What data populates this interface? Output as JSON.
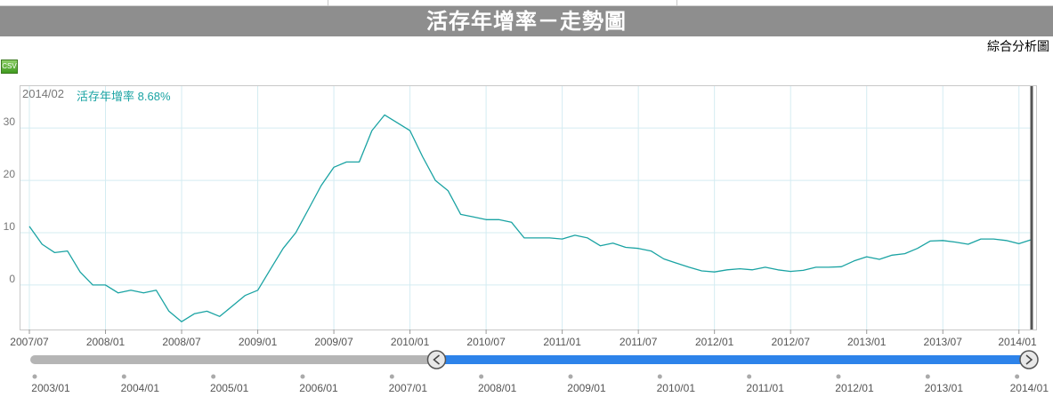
{
  "header": {
    "title": "活存年增率－走勢圖"
  },
  "links": {
    "analysis": "綜合分析圖"
  },
  "toolbar": {
    "csv_label": "CSV",
    "csv_icon": "csv-icon"
  },
  "tooltip": {
    "date": "2014/02",
    "series_name": "活存年增率",
    "value": "8.68%"
  },
  "colors": {
    "line": "#1aa3a3",
    "grid": "#d4ecf2",
    "title_bg": "#8e8e8e",
    "navigator_fill": "#2d83ea",
    "navigator_track": "#b5b5b5"
  },
  "chart_data": {
    "type": "line",
    "title": "活存年增率－走勢圖",
    "x": [
      "2007/07",
      "2007/08",
      "2007/09",
      "2007/10",
      "2007/11",
      "2007/12",
      "2008/01",
      "2008/02",
      "2008/03",
      "2008/04",
      "2008/05",
      "2008/06",
      "2008/07",
      "2008/08",
      "2008/09",
      "2008/10",
      "2008/11",
      "2008/12",
      "2009/01",
      "2009/02",
      "2009/03",
      "2009/04",
      "2009/05",
      "2009/06",
      "2009/07",
      "2009/08",
      "2009/09",
      "2009/10",
      "2009/11",
      "2009/12",
      "2010/01",
      "2010/02",
      "2010/03",
      "2010/04",
      "2010/05",
      "2010/06",
      "2010/07",
      "2010/08",
      "2010/09",
      "2010/10",
      "2010/11",
      "2010/12",
      "2011/01",
      "2011/02",
      "2011/03",
      "2011/04",
      "2011/05",
      "2011/06",
      "2011/07",
      "2011/08",
      "2011/09",
      "2011/10",
      "2011/11",
      "2011/12",
      "2012/01",
      "2012/02",
      "2012/03",
      "2012/04",
      "2012/05",
      "2012/06",
      "2012/07",
      "2012/08",
      "2012/09",
      "2012/10",
      "2012/11",
      "2012/12",
      "2013/01",
      "2013/02",
      "2013/03",
      "2013/04",
      "2013/05",
      "2013/06",
      "2013/07",
      "2013/08",
      "2013/09",
      "2013/10",
      "2013/11",
      "2013/12",
      "2014/01",
      "2014/02"
    ],
    "series": [
      {
        "name": "活存年增率",
        "values": [
          11.2,
          7.8,
          6.2,
          6.5,
          2.5,
          0,
          0,
          -1.5,
          -1,
          -1.5,
          -1,
          -5,
          -7,
          -5.5,
          -5,
          -6,
          -4,
          -2,
          -1,
          3,
          7,
          10,
          14.5,
          19,
          22.5,
          23.5,
          23.5,
          29.5,
          32.5,
          31,
          29.5,
          24.5,
          20,
          18,
          13.5,
          13,
          12.5,
          12.5,
          12,
          9,
          9,
          9,
          8.8,
          9.5,
          9,
          7.5,
          8,
          7.2,
          7,
          6.5,
          5,
          4.2,
          3.4,
          2.7,
          2.5,
          2.9,
          3.1,
          2.9,
          3.4,
          2.9,
          2.6,
          2.8,
          3.4,
          3.4,
          3.5,
          4.6,
          5.4,
          4.9,
          5.7,
          6,
          7,
          8.4,
          8.5,
          8.2,
          7.8,
          8.8,
          8.8,
          8.5,
          7.9,
          8.68
        ]
      }
    ],
    "yticks": [
      0,
      10,
      20,
      30
    ],
    "ylim": [
      -8.5,
      38
    ],
    "xticks": [
      "2007/07",
      "2008/01",
      "2008/07",
      "2009/01",
      "2009/07",
      "2010/01",
      "2010/07",
      "2011/01",
      "2011/07",
      "2012/01",
      "2012/07",
      "2013/01",
      "2013/07",
      "2014/01"
    ],
    "grid": true,
    "navigator": {
      "labels": [
        "2003/01",
        "2004/01",
        "2005/01",
        "2006/01",
        "2007/01",
        "2008/01",
        "2009/01",
        "2010/01",
        "2011/01",
        "2012/01",
        "2013/01",
        "2014/01"
      ],
      "range_start": "2007/07",
      "range_end": "2014/02"
    }
  }
}
